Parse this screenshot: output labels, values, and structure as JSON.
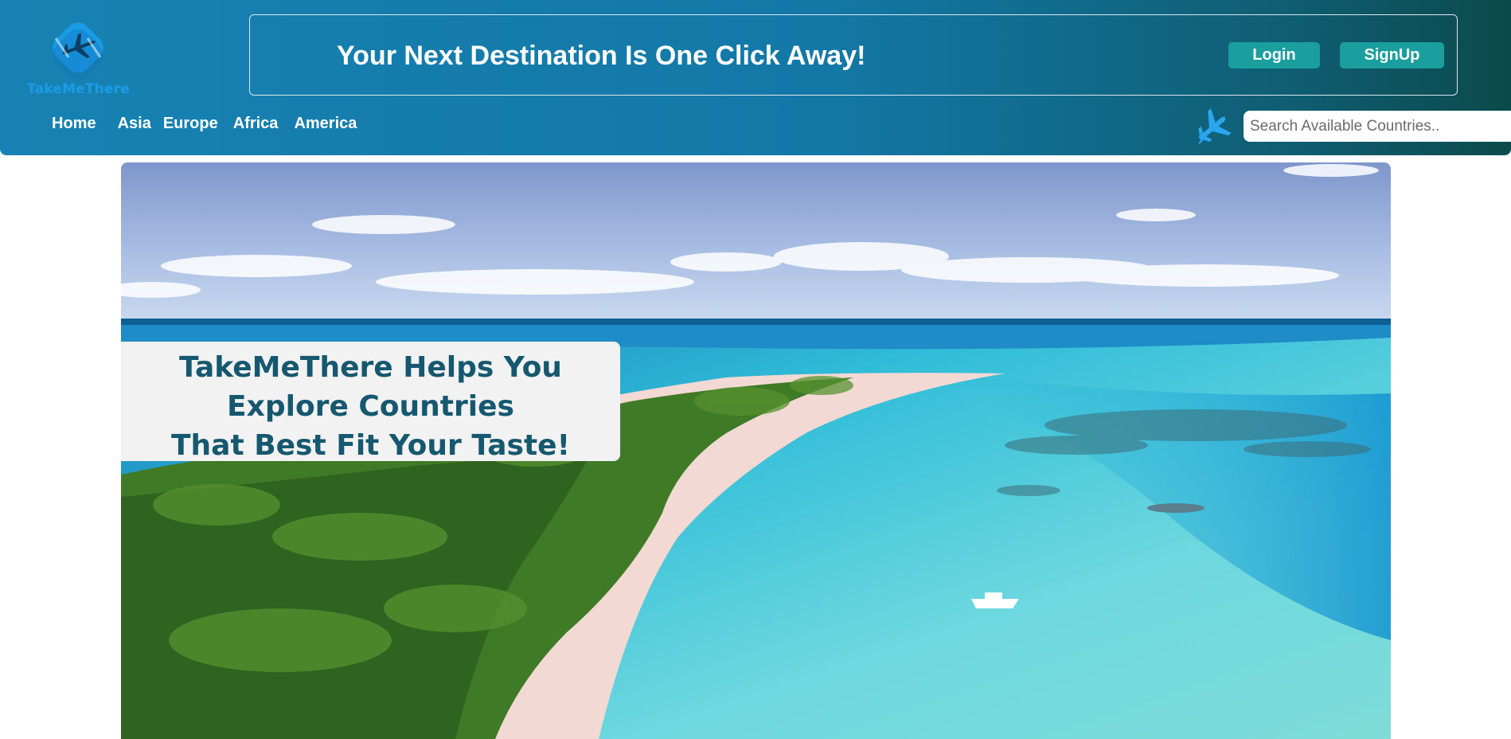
{
  "brand": {
    "logo_text": "TakeMeThere",
    "logo_icon": "plane-badge-icon"
  },
  "banner": {
    "title": "Your Next Destination Is One Click Away!",
    "login_label": "Login",
    "signup_label": "SignUp"
  },
  "nav": {
    "items": [
      {
        "label": "Home"
      },
      {
        "label": "Asia"
      },
      {
        "label": "Europe"
      },
      {
        "label": "Africa"
      },
      {
        "label": "America"
      }
    ]
  },
  "search": {
    "placeholder": "Search Available Countries..",
    "icon": "airplane-icon"
  },
  "hero": {
    "image": "tropical-island-beach-photo",
    "lines": [
      "TakeMeThere Helps You",
      "Explore Countries",
      "That Best Fit Your Taste!"
    ]
  },
  "colors": {
    "header_start": "#1782b3",
    "header_end": "#0b4a4c",
    "button_bg": "#1a9e9e",
    "hero_text": "#15586f",
    "logo_blue": "#1a9be6"
  }
}
